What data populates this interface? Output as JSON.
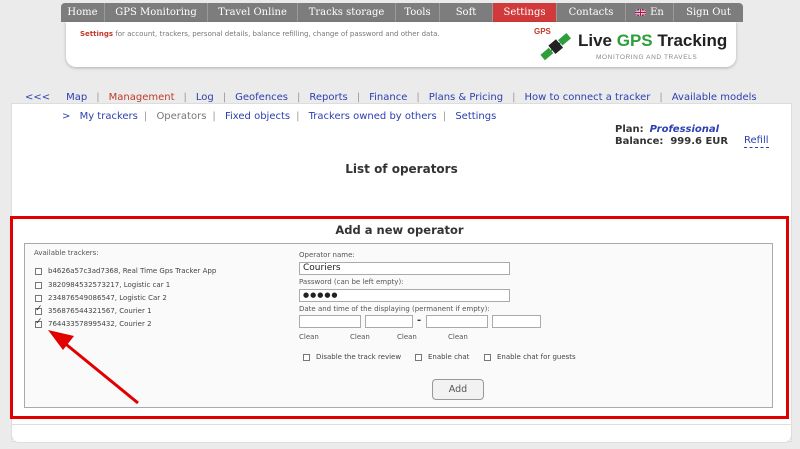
{
  "topnav": {
    "items": [
      {
        "label": "Home",
        "width": 44
      },
      {
        "label": "GPS Monitoring",
        "width": 103
      },
      {
        "label": "Travel Online",
        "width": 90
      },
      {
        "label": "Tracks storage",
        "width": 98
      },
      {
        "label": "Tools",
        "width": 44
      },
      {
        "label": "Soft",
        "width": 53
      },
      {
        "label": "Settings",
        "width": 64
      },
      {
        "label": "Contacts",
        "width": 69
      },
      {
        "label": "En",
        "width": 48
      },
      {
        "label": "Sign Out",
        "width": 69
      }
    ],
    "active": "Settings"
  },
  "header": {
    "desc_bold": "Settings",
    "desc_rest": " for account, trackers, personal details, balance refilling, change of password and other data.",
    "logo_gps": "GPS",
    "logo_title_1": "Live ",
    "logo_title_2": "GPS",
    "logo_title_3": " Tracking",
    "logo_sub": "MONITORING AND TRAVELS"
  },
  "mainmenu": {
    "back": "<<<",
    "items": [
      "Map",
      "Management",
      "Log",
      "Geofences",
      "Reports",
      "Finance",
      "Plans & Pricing",
      "How to connect a tracker",
      "Available models"
    ],
    "active": "Management"
  },
  "submenu": {
    "arrow": ">",
    "items": [
      "My trackers",
      "Operators",
      "Fixed objects",
      "Trackers owned by others",
      "Settings"
    ],
    "active": "Operators"
  },
  "account": {
    "plan_label": "Plan:",
    "plan_value": "Professional",
    "balance_label": "Balance:",
    "balance_value": "999.6 EUR",
    "refill": "Refill"
  },
  "page_title": "List of operators",
  "form": {
    "title": "Add a new operator",
    "available_label": "Available trackers:",
    "trackers": [
      {
        "label": "b4626a57c3ad7368, Real Time Gps Tracker App",
        "checked": false
      },
      {
        "label": "3820984532573217, Logistic car 1",
        "checked": false
      },
      {
        "label": "234876549086547, Logistic Car 2",
        "checked": false
      },
      {
        "label": "356876544321567, Courier 1",
        "checked": true
      },
      {
        "label": "764433578995432, Courier 2",
        "checked": true
      }
    ],
    "operator_name_label": "Operator name:",
    "operator_name_value": "Couriers",
    "password_label": "Password (can be left empty):",
    "password_value": "●●●●●",
    "datetime_label": "Date and time of the displaying (permanent if empty):",
    "range_sep": "-",
    "clean_label": "Clean",
    "options": [
      {
        "label": "Disable the track review",
        "checked": false
      },
      {
        "label": "Enable chat",
        "checked": false
      },
      {
        "label": "Enable chat for guests",
        "checked": false
      }
    ],
    "add_button": "Add"
  },
  "colors": {
    "nav_active": "#d13a3a",
    "link": "#2b3fb0",
    "highlight": "#e00000"
  }
}
